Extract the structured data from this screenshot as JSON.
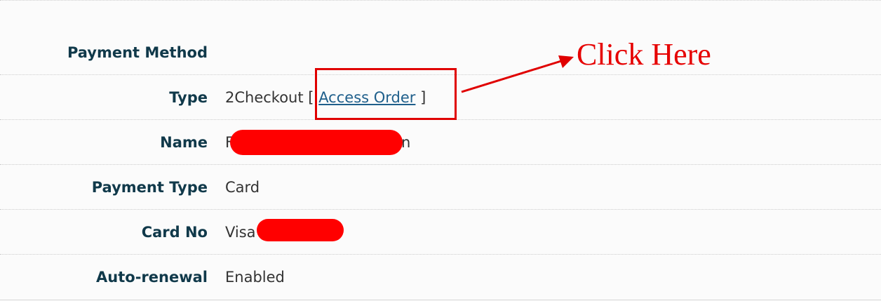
{
  "section": {
    "title": "Payment Method"
  },
  "rows": [
    {
      "label": "Type",
      "value_prefix": "2Checkout",
      "bracket_open": "[",
      "link_text": "Access Order",
      "bracket_close": "]"
    },
    {
      "label": "Name",
      "value_start": "F",
      "value_end": "n",
      "redacted": true
    },
    {
      "label": "Payment Type",
      "value": "Card"
    },
    {
      "label": "Card No",
      "value": "Visa",
      "redacted": true
    },
    {
      "label": "Auto-renewal",
      "value": "Enabled"
    }
  ],
  "annotation": {
    "text": "Click Here",
    "color": "#e60000"
  },
  "colors": {
    "label": "#10394a",
    "link": "#1f5f8b",
    "redaction": "#ff0000"
  }
}
